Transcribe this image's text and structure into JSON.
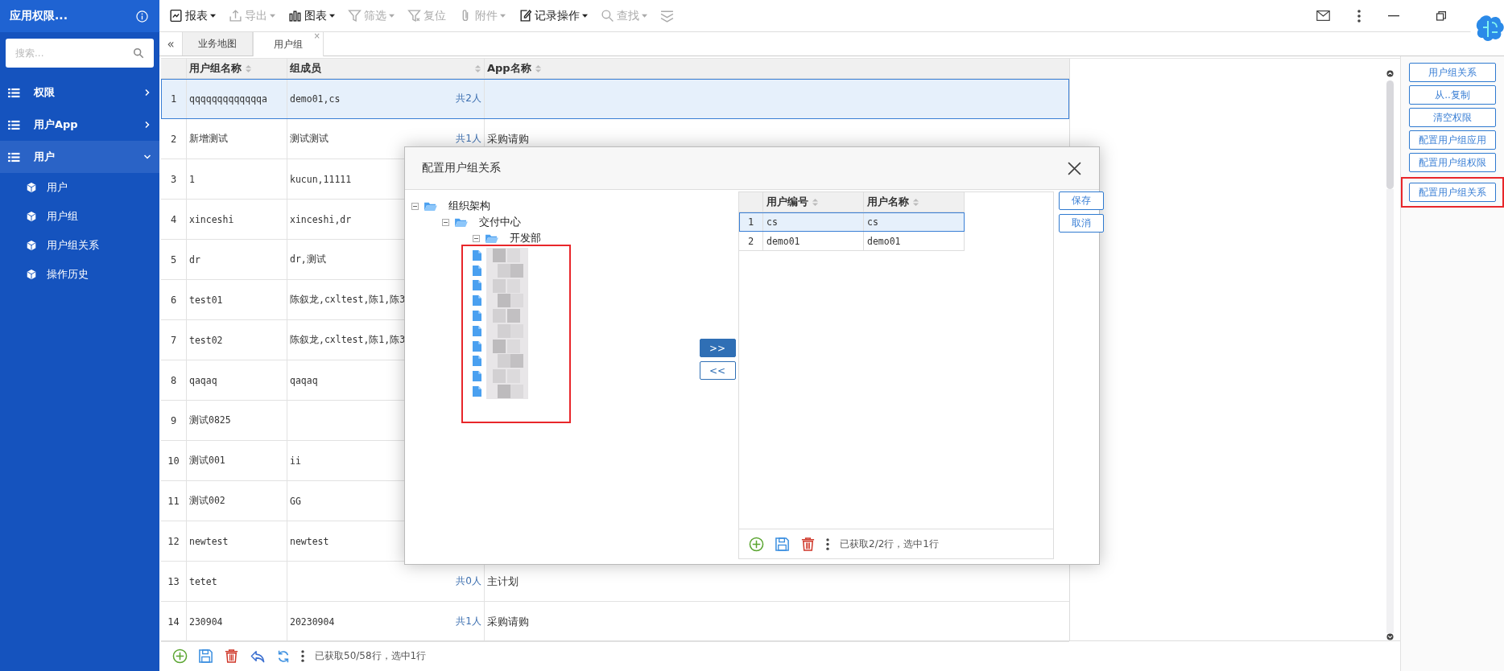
{
  "sidebar": {
    "title": "应用权限...",
    "search": {
      "placeholder": "搜索..."
    },
    "items": [
      {
        "label": "权限",
        "expanded": false,
        "selected": false
      },
      {
        "label": "用户App",
        "expanded": false,
        "selected": false
      },
      {
        "label": "用户",
        "expanded": true,
        "selected": true,
        "children": [
          {
            "label": "用户"
          },
          {
            "label": "用户组"
          },
          {
            "label": "用户组关系"
          },
          {
            "label": "操作历史"
          }
        ]
      }
    ]
  },
  "toolbar": [
    {
      "label": "报表",
      "dropdown": true,
      "disabled": false
    },
    {
      "label": "导出",
      "dropdown": true,
      "disabled": true
    },
    {
      "label": "图表",
      "dropdown": true,
      "disabled": false
    },
    {
      "label": "筛选",
      "dropdown": true,
      "disabled": true
    },
    {
      "label": "复位",
      "dropdown": false,
      "disabled": true
    },
    {
      "label": "附件",
      "dropdown": true,
      "disabled": true
    },
    {
      "label": "记录操作",
      "dropdown": true,
      "disabled": false
    },
    {
      "label": "查找",
      "dropdown": true,
      "disabled": true
    },
    {
      "dropdown": false,
      "disabled": true
    }
  ],
  "tabs": {
    "collapse": "«",
    "items": [
      {
        "label": "业务地图",
        "selected": false
      },
      {
        "label": "用户组",
        "selected": true,
        "close": "×"
      }
    ]
  },
  "table": {
    "columns": [
      "用户组名称",
      "组成员",
      "App名称"
    ],
    "rows": [
      {
        "index": "1",
        "name": "qqqqqqqqqqqqqa",
        "members": "demo01,cs",
        "count": "共2人",
        "selected": true
      },
      {
        "index": "2",
        "name": "新增测试",
        "members": "测试测试",
        "count": "共1人",
        "app": "采购请购",
        "selected": false
      },
      {
        "index": "3",
        "name": "1",
        "members": "kucun,11111",
        "selected": false
      },
      {
        "index": "4",
        "name": "xinceshi",
        "members": "xinceshi,dr",
        "selected": false
      },
      {
        "index": "5",
        "name": "dr",
        "members": "dr,测试",
        "selected": false
      },
      {
        "index": "6",
        "name": "test01",
        "members": "陈叙龙,cxltest,陈1,陈3",
        "selected": false
      },
      {
        "index": "7",
        "name": "test02",
        "members": "陈叙龙,cxltest,陈1,陈3",
        "selected": false
      },
      {
        "index": "8",
        "name": "qaqaq",
        "members": "qaqaq",
        "selected": false
      },
      {
        "index": "9",
        "name": "测试0825",
        "selected": false
      },
      {
        "index": "10",
        "name": "测试001",
        "members": "ii",
        "selected": false
      },
      {
        "index": "11",
        "name": "测试002",
        "members": "GG",
        "selected": false
      },
      {
        "index": "12",
        "name": "newtest",
        "members": "newtest",
        "selected": false
      },
      {
        "index": "13",
        "name": "tetet",
        "count": "共0人",
        "app": "主计划",
        "selected": false
      },
      {
        "index": "14",
        "name": "230904",
        "members": "20230904",
        "count": "共1人",
        "app": "采购请购",
        "selected": false
      }
    ]
  },
  "status": "已获取50/58行，选中1行",
  "side_buttons": [
    {
      "label": "用户组关系",
      "highlighted": false
    },
    {
      "label": "从..复制",
      "highlighted": false
    },
    {
      "label": "清空权限",
      "highlighted": false
    },
    {
      "label": "配置用户组应用",
      "highlighted": false
    },
    {
      "label": "配置用户组权限",
      "highlighted": false
    },
    {
      "label": "配置用户组关系",
      "highlighted": true
    }
  ],
  "dialog": {
    "title": "配置用户组关系",
    "tree": [
      {
        "label": "组织架构",
        "expanded": true,
        "children": [
          {
            "label": "交付中心",
            "expanded": true,
            "children": [
              {
                "label": "开发部",
                "expanded": true,
                "highlighted": true,
                "children": [
                  {
                    "redacted": true
                  },
                  {
                    "redacted": true
                  },
                  {
                    "redacted": true
                  },
                  {
                    "redacted": true
                  },
                  {
                    "redacted": true
                  },
                  {
                    "redacted": true
                  },
                  {
                    "redacted": true
                  },
                  {
                    "redacted": true
                  },
                  {
                    "redacted": true
                  },
                  {
                    "redacted": true
                  }
                ]
              }
            ]
          }
        ]
      }
    ],
    "move_right": ">>",
    "move_left": "<<",
    "grid": {
      "columns": [
        "用户编号",
        "用户名称"
      ],
      "rows": [
        {
          "index": "1",
          "code": "cs",
          "name": "cs",
          "selected": true
        },
        {
          "index": "2",
          "code": "demo01",
          "name": "demo01",
          "selected": false
        }
      ]
    },
    "status": "已获取2/2行，选中1行",
    "buttons": [
      "保存",
      "取消"
    ]
  }
}
